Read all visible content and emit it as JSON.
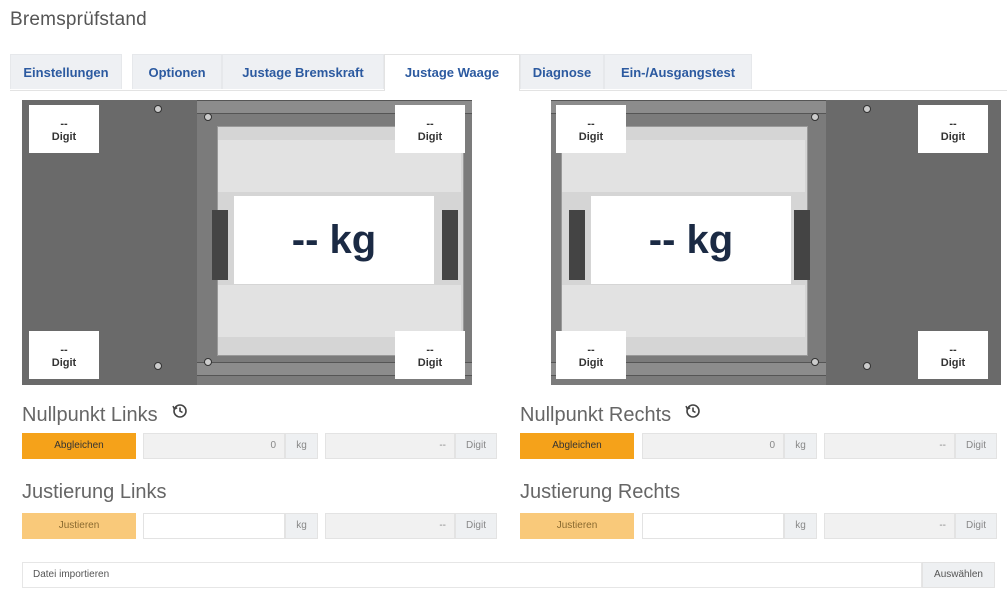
{
  "page": {
    "title": "Bremsprüfstand"
  },
  "tabs": [
    {
      "label": "Einstellungen"
    },
    {
      "label": "Optionen"
    },
    {
      "label": "Justage Bremskraft"
    },
    {
      "label": "Justage Waage",
      "active": true
    },
    {
      "label": "Diagnose"
    },
    {
      "label": "Ein-/Ausgangstest"
    }
  ],
  "left_scale": {
    "weight": "-- kg",
    "corners": [
      {
        "value": "--",
        "unit": "Digit"
      },
      {
        "value": "--",
        "unit": "Digit"
      },
      {
        "value": "--",
        "unit": "Digit"
      },
      {
        "value": "--",
        "unit": "Digit"
      }
    ]
  },
  "right_scale": {
    "weight": "-- kg",
    "corners": [
      {
        "value": "--",
        "unit": "Digit"
      },
      {
        "value": "--",
        "unit": "Digit"
      },
      {
        "value": "--",
        "unit": "Digit"
      },
      {
        "value": "--",
        "unit": "Digit"
      }
    ]
  },
  "left": {
    "zero_title": "Nullpunkt Links",
    "zero_button": "Abgleichen",
    "zero_kg_value": "0",
    "zero_kg_unit": "kg",
    "zero_digit_value": "--",
    "zero_digit_unit": "Digit",
    "adjust_title": "Justierung Links",
    "adjust_button": "Justieren",
    "adjust_kg_value": "",
    "adjust_kg_unit": "kg",
    "adjust_digit_value": "--",
    "adjust_digit_unit": "Digit"
  },
  "right": {
    "zero_title": "Nullpunkt Rechts",
    "zero_button": "Abgleichen",
    "zero_kg_value": "0",
    "zero_kg_unit": "kg",
    "zero_digit_value": "--",
    "zero_digit_unit": "Digit",
    "adjust_title": "Justierung Rechts",
    "adjust_button": "Justieren",
    "adjust_kg_value": "",
    "adjust_kg_unit": "kg",
    "adjust_digit_value": "--",
    "adjust_digit_unit": "Digit"
  },
  "import": {
    "placeholder": "Datei importieren",
    "button": "Auswählen"
  },
  "colors": {
    "accent": "#f5a21a",
    "accent_disabled": "#f9c97a",
    "tab_text": "#2c5aa0",
    "scale_frame": "#6a6a6a"
  }
}
